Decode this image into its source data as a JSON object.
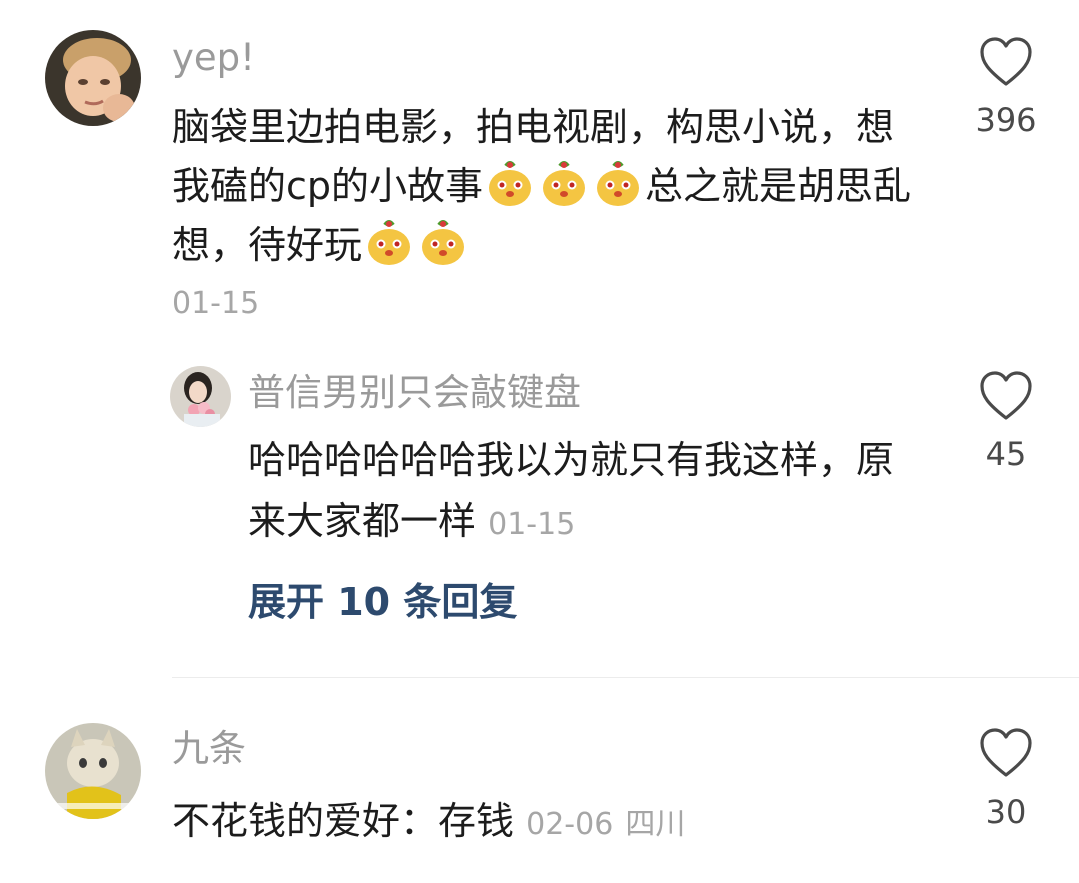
{
  "comments": [
    {
      "username": "yep!",
      "text_parts": [
        "脑袋里边拍电影，拍电视剧，构思小说，想我磕的cp的小故事",
        "总之就是胡思乱想，待好玩"
      ],
      "emoji": "squash-face-emoji",
      "date": "01-15",
      "likes": "396",
      "reply": {
        "username": "普信男别只会敲键盘",
        "text": "哈哈哈哈哈哈我以为就只有我这样，原来大家都一样",
        "date": "01-15",
        "likes": "45"
      },
      "expand_label": "展开 10 条回复"
    },
    {
      "username": "九条",
      "text": "不花钱的爱好：存钱",
      "date": "02-06",
      "location": "四川",
      "likes": "30"
    }
  ],
  "icons": {
    "like": "heart-outline-icon"
  },
  "colors": {
    "username": "#9a9a9a",
    "text": "#1c1c1c",
    "expand": "#2d4a6e",
    "meta": "#a6a6a6"
  }
}
